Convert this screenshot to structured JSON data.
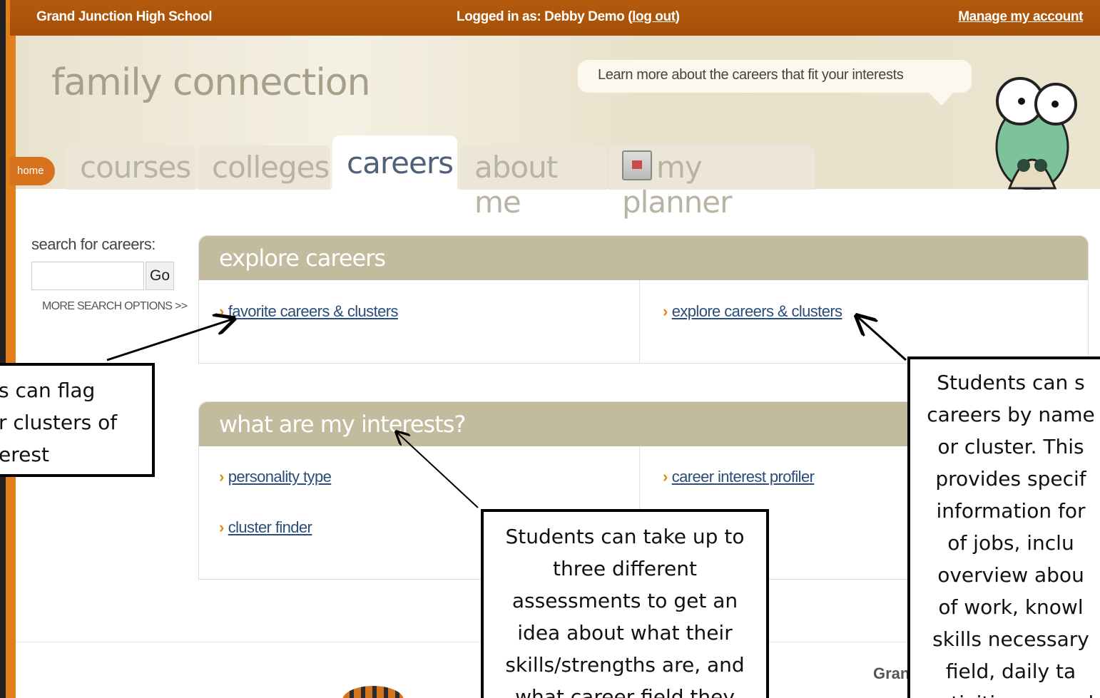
{
  "topbar": {
    "school": "Grand Junction High School",
    "login_prefix": "Logged in as: Debby Demo (",
    "logout": "log out",
    "login_suffix": ")",
    "manage": "Manage my account"
  },
  "header": {
    "brand": "family connection",
    "bubble": "Learn more about the careers that fit your interests",
    "home": "home"
  },
  "tabs": [
    {
      "label": "courses"
    },
    {
      "label": "colleges"
    },
    {
      "label": "careers",
      "active": true
    },
    {
      "label": "about me"
    },
    {
      "label": "my planner"
    }
  ],
  "search": {
    "label": "search for careers:",
    "placeholder": "",
    "go": "Go",
    "more": "MORE SEARCH OPTIONS >>"
  },
  "explore": {
    "title": "explore careers",
    "links": [
      "favorite careers & clusters",
      "explore careers & clusters"
    ]
  },
  "interests": {
    "title": "what are my interests?",
    "links": [
      "personality type",
      "cluster finder",
      "career interest profiler"
    ]
  },
  "footer": {
    "partial_text": "Gran"
  },
  "callouts": {
    "left": [
      "s can flag",
      "r clusters of",
      "erest"
    ],
    "mid": [
      "Students can take up to",
      "three different",
      "assessments to get an",
      "idea about what their",
      "skills/strengths are, and",
      "what career field they"
    ],
    "right": [
      "Students can s",
      "careers by name",
      "or cluster.  This",
      "provides specif",
      "information for",
      "of jobs, inclu",
      "overview abou",
      "of work, knowl",
      "skills necessary",
      "field, daily ta",
      "activities, as wel"
    ]
  },
  "colors": {
    "topbar": "#a54f08",
    "accent_orange": "#e07f1c",
    "panel_header": "#c3bb9e",
    "link": "#2b4d79"
  }
}
